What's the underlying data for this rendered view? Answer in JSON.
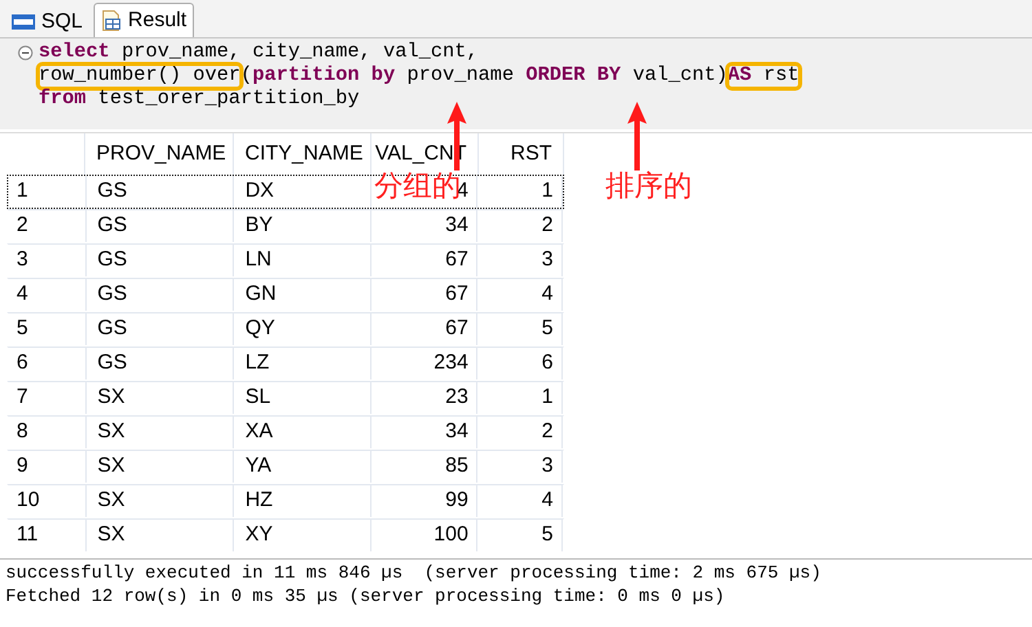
{
  "tabs": [
    {
      "label": "SQL",
      "selected": false
    },
    {
      "label": "Result",
      "selected": true
    }
  ],
  "editor": {
    "lines": [
      [
        {
          "boxed": false,
          "parts": [
            {
              "text": "select",
              "kind": "keyword"
            },
            {
              "text": " prov_name, city_name, val_cnt,",
              "kind": "plain"
            }
          ]
        }
      ],
      [
        {
          "boxed": true,
          "parts": [
            {
              "text": "row_number() over",
              "kind": "plain"
            }
          ]
        },
        {
          "boxed": false,
          "parts": [
            {
              "text": "(",
              "kind": "plain"
            },
            {
              "text": "partition by",
              "kind": "keyword"
            },
            {
              "text": " prov_name ",
              "kind": "plain"
            },
            {
              "text": "ORDER BY",
              "kind": "keyword"
            },
            {
              "text": " val_cnt)",
              "kind": "plain"
            }
          ]
        },
        {
          "boxed": true,
          "parts": [
            {
              "text": "AS",
              "kind": "keyword"
            },
            {
              "text": " rst",
              "kind": "plain"
            }
          ]
        }
      ],
      [
        {
          "boxed": false,
          "parts": [
            {
              "text": "from",
              "kind": "keyword"
            },
            {
              "text": " test_orer_partition_by",
              "kind": "plain"
            }
          ]
        }
      ]
    ]
  },
  "annotations": [
    {
      "text": "分组的"
    },
    {
      "text": "排序的"
    }
  ],
  "table": {
    "columns": [
      "",
      "PROV_NAME",
      "CITY_NAME",
      "VAL_CNT",
      "RST"
    ],
    "rows": [
      {
        "cells": [
          "1",
          "GS",
          "DX",
          "4",
          "1"
        ],
        "focused": true
      },
      {
        "cells": [
          "2",
          "GS",
          "BY",
          "34",
          "2"
        ],
        "focused": false
      },
      {
        "cells": [
          "3",
          "GS",
          "LN",
          "67",
          "3"
        ],
        "focused": false
      },
      {
        "cells": [
          "4",
          "GS",
          "GN",
          "67",
          "4"
        ],
        "focused": false
      },
      {
        "cells": [
          "5",
          "GS",
          "QY",
          "67",
          "5"
        ],
        "focused": false
      },
      {
        "cells": [
          "6",
          "GS",
          "LZ",
          "234",
          "6"
        ],
        "focused": false
      },
      {
        "cells": [
          "7",
          "SX",
          "SL",
          "23",
          "1"
        ],
        "focused": false
      },
      {
        "cells": [
          "8",
          "SX",
          "XA",
          "34",
          "2"
        ],
        "focused": false
      },
      {
        "cells": [
          "9",
          "SX",
          "YA",
          "85",
          "3"
        ],
        "focused": false
      },
      {
        "cells": [
          "10",
          "SX",
          "HZ",
          "99",
          "4"
        ],
        "focused": false
      },
      {
        "cells": [
          "11",
          "SX",
          "XY",
          "100",
          "5"
        ],
        "focused": false
      }
    ]
  },
  "messages": [
    "successfully executed in 11 ms 846 µs  (server processing time: 2 ms 675 µs)",
    "Fetched 12 row(s) in 0 ms 35 µs (server processing time: 0 ms 0 µs)"
  ]
}
